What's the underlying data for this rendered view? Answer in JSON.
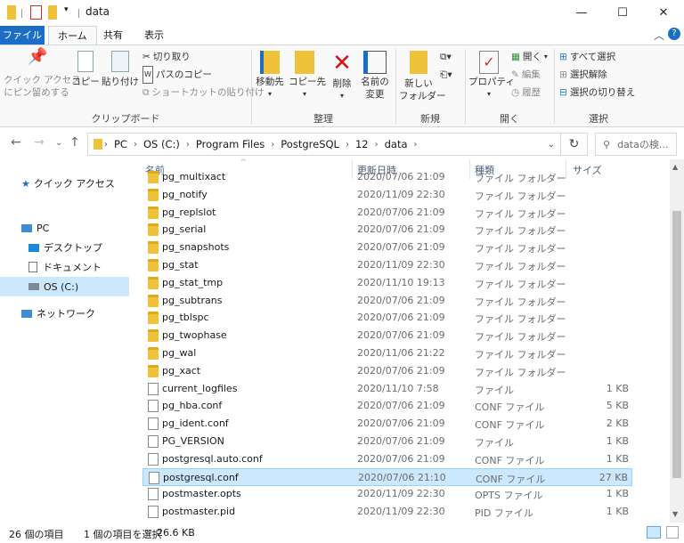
{
  "window": {
    "title": "data",
    "minimize": "—",
    "maximize": "☐",
    "close": "✕"
  },
  "tabs": {
    "file": "ファイル",
    "home": "ホーム",
    "share": "共有",
    "view": "表示",
    "collapse": "︿",
    "help": "?"
  },
  "ribbon": {
    "clipboard": {
      "pin_line1": "クイック アクセス",
      "pin_line2": "にピン留めする",
      "copy": "コピー",
      "paste": "貼り付け",
      "cut": "切り取り",
      "copy_path": "パスのコピー",
      "paste_shortcut": "ショートカットの貼り付け",
      "label": "クリップボード"
    },
    "organize": {
      "move_to": "移動先",
      "copy_to": "コピー先",
      "delete": "削除",
      "rename_line1": "名前の",
      "rename_line2": "変更",
      "label": "整理"
    },
    "new": {
      "new_folder_line1": "新しい",
      "new_folder_line2": "フォルダー",
      "label": "新規"
    },
    "open": {
      "properties": "プロパティ",
      "open": "開く",
      "edit": "編集",
      "history": "履歴",
      "label": "開く"
    },
    "select": {
      "select_all": "すべて選択",
      "select_none": "選択解除",
      "invert": "選択の切り替え",
      "label": "選択"
    }
  },
  "address": {
    "crumbs": [
      "PC",
      "OS (C:)",
      "Program Files",
      "PostgreSQL",
      "12",
      "data"
    ],
    "search_placeholder": "dataの検..."
  },
  "nav": {
    "quick_access": "クイック アクセス",
    "pc": "PC",
    "desktop": "デスクトップ",
    "documents": "ドキュメント",
    "os_c": "OS (C:)",
    "network": "ネットワーク"
  },
  "columns": {
    "name": "名前",
    "date": "更新日時",
    "type": "種類",
    "size": "サイズ"
  },
  "rows": [
    {
      "name": "pg_multixact",
      "date": "2020/07/06 21:09",
      "type": "ファイル フォルダー",
      "size": "",
      "kind": "folder"
    },
    {
      "name": "pg_notify",
      "date": "2020/11/09 22:30",
      "type": "ファイル フォルダー",
      "size": "",
      "kind": "folder"
    },
    {
      "name": "pg_replslot",
      "date": "2020/07/06 21:09",
      "type": "ファイル フォルダー",
      "size": "",
      "kind": "folder"
    },
    {
      "name": "pg_serial",
      "date": "2020/07/06 21:09",
      "type": "ファイル フォルダー",
      "size": "",
      "kind": "folder"
    },
    {
      "name": "pg_snapshots",
      "date": "2020/07/06 21:09",
      "type": "ファイル フォルダー",
      "size": "",
      "kind": "folder"
    },
    {
      "name": "pg_stat",
      "date": "2020/11/09 22:30",
      "type": "ファイル フォルダー",
      "size": "",
      "kind": "folder"
    },
    {
      "name": "pg_stat_tmp",
      "date": "2020/11/10 19:13",
      "type": "ファイル フォルダー",
      "size": "",
      "kind": "folder"
    },
    {
      "name": "pg_subtrans",
      "date": "2020/07/06 21:09",
      "type": "ファイル フォルダー",
      "size": "",
      "kind": "folder"
    },
    {
      "name": "pg_tblspc",
      "date": "2020/07/06 21:09",
      "type": "ファイル フォルダー",
      "size": "",
      "kind": "folder"
    },
    {
      "name": "pg_twophase",
      "date": "2020/07/06 21:09",
      "type": "ファイル フォルダー",
      "size": "",
      "kind": "folder"
    },
    {
      "name": "pg_wal",
      "date": "2020/11/06 21:22",
      "type": "ファイル フォルダー",
      "size": "",
      "kind": "folder"
    },
    {
      "name": "pg_xact",
      "date": "2020/07/06 21:09",
      "type": "ファイル フォルダー",
      "size": "",
      "kind": "folder"
    },
    {
      "name": "current_logfiles",
      "date": "2020/11/10 7:58",
      "type": "ファイル",
      "size": "1 KB",
      "kind": "file"
    },
    {
      "name": "pg_hba.conf",
      "date": "2020/07/06 21:09",
      "type": "CONF ファイル",
      "size": "5 KB",
      "kind": "file"
    },
    {
      "name": "pg_ident.conf",
      "date": "2020/07/06 21:09",
      "type": "CONF ファイル",
      "size": "2 KB",
      "kind": "file"
    },
    {
      "name": "PG_VERSION",
      "date": "2020/07/06 21:09",
      "type": "ファイル",
      "size": "1 KB",
      "kind": "file"
    },
    {
      "name": "postgresql.auto.conf",
      "date": "2020/07/06 21:09",
      "type": "CONF ファイル",
      "size": "1 KB",
      "kind": "file"
    },
    {
      "name": "postgresql.conf",
      "date": "2020/07/06 21:10",
      "type": "CONF ファイル",
      "size": "27 KB",
      "kind": "file",
      "selected": true
    },
    {
      "name": "postmaster.opts",
      "date": "2020/11/09 22:30",
      "type": "OPTS ファイル",
      "size": "1 KB",
      "kind": "file"
    },
    {
      "name": "postmaster.pid",
      "date": "2020/11/09 22:30",
      "type": "PID ファイル",
      "size": "1 KB",
      "kind": "file"
    }
  ],
  "status": {
    "count": "26 個の項目",
    "selection": "1 個の項目を選択",
    "size": "26.6 KB"
  },
  "scroll_position": 0.55,
  "colors": {
    "file_tab": "#1a6fc4",
    "selection": "#cce8ff",
    "folder": "#f0c23b"
  }
}
